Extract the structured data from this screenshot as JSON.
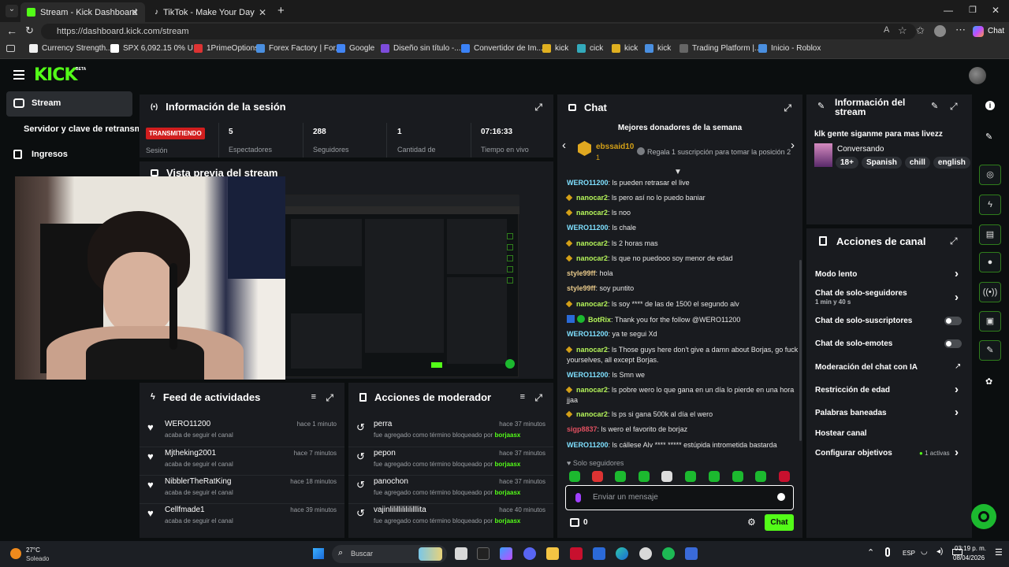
{
  "browser": {
    "tabs": [
      {
        "title": "Stream - Kick Dashboard",
        "active": true
      },
      {
        "title": "TikTok - Make Your Day",
        "active": false
      }
    ],
    "url": "https://dashboard.kick.com/stream",
    "profile_label": "Chat",
    "bookmarks": [
      {
        "label": "Currency Strength...",
        "color": "#f0f0f0"
      },
      {
        "label": "SPX 6,092.15 0% U...",
        "color": "#ffffff"
      },
      {
        "label": "1PrimeOptions",
        "color": "#d33"
      },
      {
        "label": "Forex Factory | For...",
        "color": "#4a8fe0"
      },
      {
        "label": "Google",
        "color": "#4285f4"
      },
      {
        "label": "Diseño sin título -...",
        "color": "#7d4cdb"
      },
      {
        "label": "Convertidor de Im...",
        "color": "#3b82f6"
      },
      {
        "label": "kick",
        "color": "#e0b020"
      },
      {
        "label": "cick",
        "color": "#3ab"
      },
      {
        "label": "kick",
        "color": "#e0b020"
      },
      {
        "label": "kick",
        "color": "#4a8fe0"
      },
      {
        "label": "Trading Platform |...",
        "color": "#666"
      },
      {
        "label": "Inicio - Roblox",
        "color": "#4a8fe0"
      }
    ]
  },
  "app": {
    "logo": "KICK",
    "logo_badge": "BETA",
    "nav": {
      "stream": "Stream",
      "server_key": "Servidor y clave de retransmisión",
      "income": "Ingresos"
    },
    "session": {
      "title": "Información de la sesión",
      "status": "TRANSMITIENDO",
      "status_label": "Sesión",
      "stats": [
        {
          "value": "5",
          "label": "Espectadores"
        },
        {
          "value": "288",
          "label": "Seguidores"
        },
        {
          "value": "1",
          "label": "Cantidad de"
        },
        {
          "value": "07:16:33",
          "label": "Tiempo en vivo"
        }
      ]
    },
    "preview": {
      "title": "Vista previa del stream"
    },
    "activity": {
      "title": "Feed de actividades",
      "items": [
        {
          "user": "WERO11200",
          "text": "acaba de seguir el canal",
          "time": "hace 1 minuto"
        },
        {
          "user": "Mjtheking2001",
          "text": "acaba de seguir el canal",
          "time": "hace 7 minutos"
        },
        {
          "user": "NibblerTheRatKing",
          "text": "acaba de seguir el canal",
          "time": "hace 18 minutos"
        },
        {
          "user": "Cellfmade1",
          "text": "acaba de seguir el canal",
          "time": "hace 39 minutos"
        }
      ]
    },
    "mod_actions": {
      "title": "Acciones de moderador",
      "items": [
        {
          "term": "perra",
          "text": "fue agregado como término bloqueado por",
          "by": "borjaasx",
          "time": "hace 37 minutos"
        },
        {
          "term": "pepon",
          "text": "fue agregado como término bloqueado por",
          "by": "borjaasx",
          "time": "hace 37 minutos"
        },
        {
          "term": "panochon",
          "text": "fue agregado como término bloqueado por",
          "by": "borjaasx",
          "time": "hace 37 minutos"
        },
        {
          "term": "vajinlilillililililllita",
          "text": "fue agregado como término bloqueado por",
          "by": "borjaasx",
          "time": "hace 40 minutos"
        }
      ]
    },
    "chat": {
      "title": "Chat",
      "top_donors": "Mejores donadores de la semana",
      "donor_name": "ebssaid10",
      "donor_rank": "1",
      "gift_text": "Regala 1 suscripción para tomar la posición 2",
      "messages": [
        {
          "user": "WERO11200",
          "text": "ls pueden retrasar el live",
          "color": "#7fe0ff",
          "badge": false
        },
        {
          "user": "nanocar2",
          "text": "ls pero así no lo puedo baniar",
          "color": "#b5f55a",
          "badge": true
        },
        {
          "user": "nanocar2",
          "text": "ls noo",
          "color": "#b5f55a",
          "badge": true
        },
        {
          "user": "WERO11200",
          "text": "ls chale",
          "color": "#7fe0ff",
          "badge": false
        },
        {
          "user": "nanocar2",
          "text": "ls 2 horas mas",
          "color": "#b5f55a",
          "badge": true
        },
        {
          "user": "nanocar2",
          "text": "ls que no puedooo soy menor de edad",
          "color": "#b5f55a",
          "badge": true
        },
        {
          "user": "style99ff",
          "text": "hola",
          "color": "#e8c98a",
          "badge": false
        },
        {
          "user": "style99ff",
          "text": "soy puntito",
          "color": "#e8c98a",
          "badge": false
        },
        {
          "user": "nanocar2",
          "text": "ls soy **** de las de 1500 el segundo alv",
          "color": "#b5f55a",
          "badge": true
        },
        {
          "user": "BotRix",
          "text": "Thank you for the follow @WERO11200",
          "color": "#b5f55a",
          "badge": false
        },
        {
          "user": "WERO11200",
          "text": "ya te segui Xd",
          "color": "#7fe0ff",
          "badge": false
        },
        {
          "user": "nanocar2",
          "text": "ls Those guys here don't give a damn about Borjas, go fuck",
          "cont": "yourselves, all except Borjas.",
          "color": "#b5f55a",
          "badge": true
        },
        {
          "user": "WERO11200",
          "text": "ls Smn we",
          "color": "#7fe0ff",
          "badge": false
        },
        {
          "user": "nanocar2",
          "text": "ls pobre wero lo que gana en un día lo pierde en una hora",
          "cont": "jjaa",
          "color": "#b5f55a",
          "badge": true
        },
        {
          "user": "nanocar2",
          "text": "ls ps si gana 500k al día el wero",
          "color": "#b5f55a",
          "badge": true
        },
        {
          "user": "sigp8837",
          "text": "ls wero el favorito de borjaz",
          "color": "#e05060",
          "badge": false
        },
        {
          "user": "WERO11200",
          "text": "ls cállese Alv **** ***** estúpida intrometida bastarda",
          "color": "#7fe0ff",
          "badge": false
        }
      ],
      "followers_only": "Solo seguidores",
      "input_placeholder": "Enviar un mensaje",
      "points": "0",
      "send": "Chat"
    },
    "stream_info": {
      "title_l1": "Información del",
      "title_l2": "stream",
      "stream_title": "klk gente siganme para mas livezz",
      "category": "Conversando",
      "tags": [
        "18+",
        "Spanish",
        "chill",
        "english"
      ]
    },
    "channel_actions": {
      "title": "Acciones de canal",
      "items": [
        {
          "label": "Modo lento"
        },
        {
          "label": "Chat de solo-seguidores",
          "sub": "1 min y 40 s"
        },
        {
          "label": "Chat de solo-suscriptores"
        },
        {
          "label": "Chat de solo-emotes"
        },
        {
          "label": "Moderación del chat con IA"
        },
        {
          "label": "Restricción de edad"
        },
        {
          "label": "Palabras baneadas"
        },
        {
          "label": "Hostear canal"
        },
        {
          "label": "Configurar objetivos",
          "status": "1 activas"
        }
      ]
    }
  },
  "taskbar": {
    "temp": "27°C",
    "weather": "Soleado",
    "search": "Buscar",
    "lang": "ESP",
    "time": "03:19 p. m.",
    "date": "08/04/2026"
  }
}
